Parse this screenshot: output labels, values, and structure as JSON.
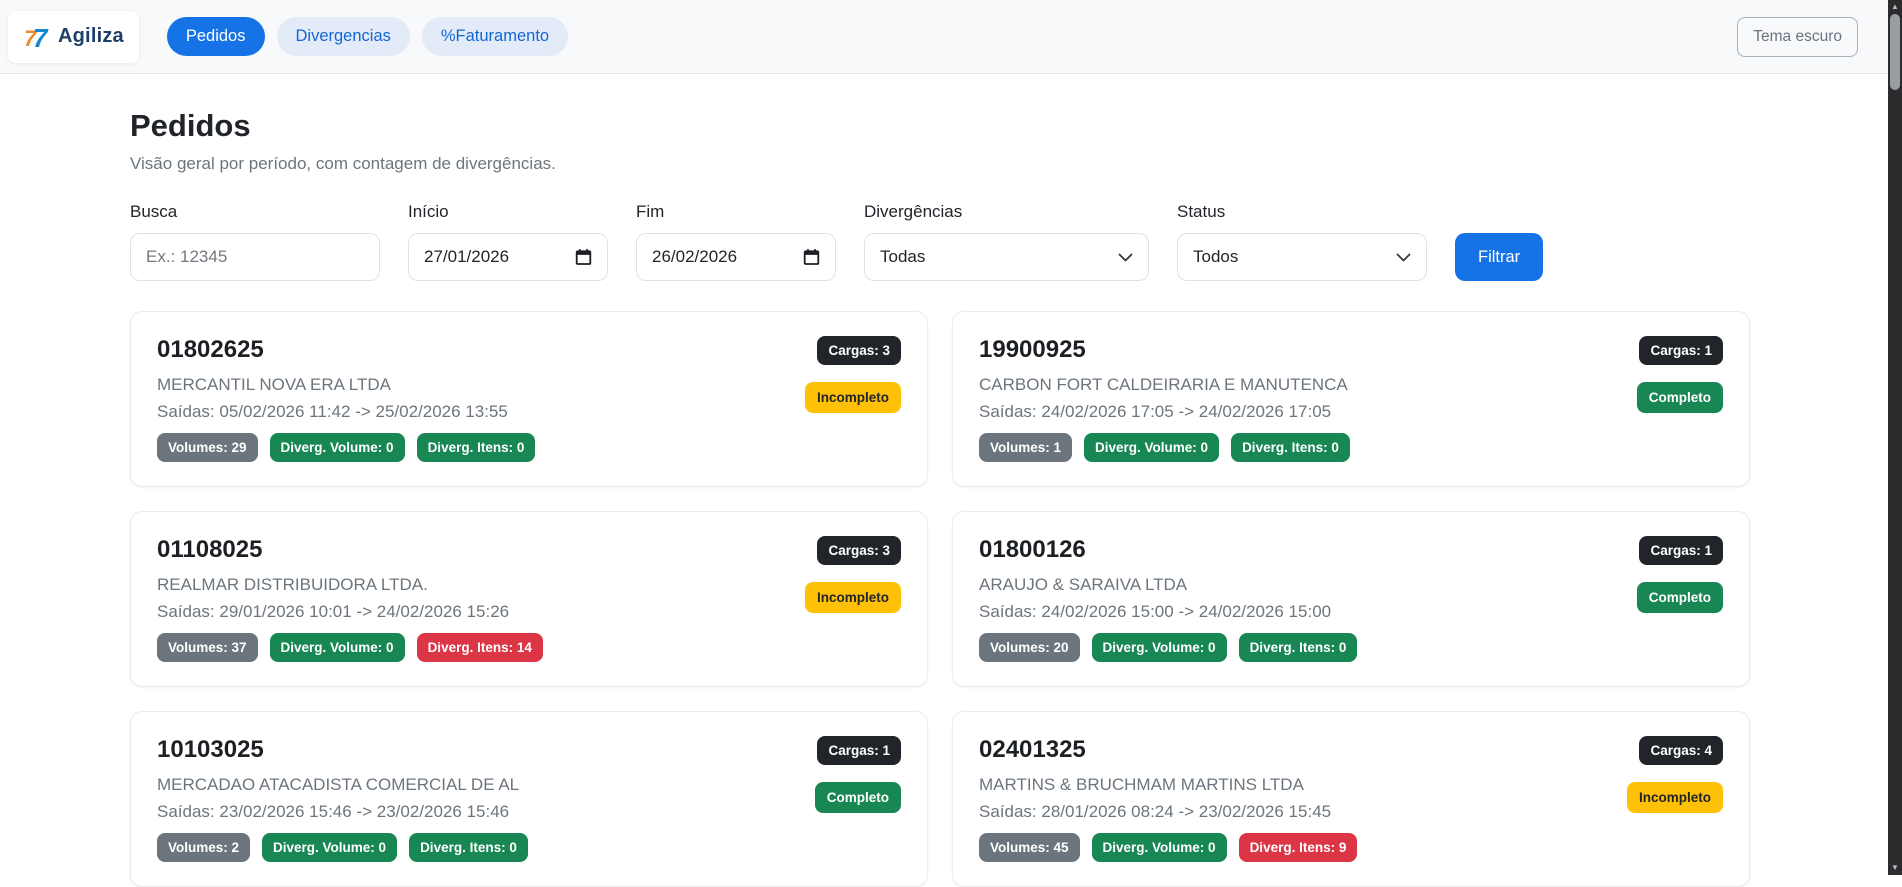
{
  "navbar": {
    "brand": "Agiliza",
    "tabs": [
      {
        "label": "Pedidos",
        "active": true
      },
      {
        "label": "Divergencias",
        "active": false
      },
      {
        "label": "%Faturamento",
        "active": false
      }
    ],
    "theme_button": "Tema escuro"
  },
  "page": {
    "title": "Pedidos",
    "subtitle": "Visão geral por período, com contagem de divergências."
  },
  "filters": {
    "busca": {
      "label": "Busca",
      "placeholder": "Ex.: 12345",
      "value": ""
    },
    "inicio": {
      "label": "Início",
      "value": "27/01/2026"
    },
    "fim": {
      "label": "Fim",
      "value": "26/02/2026"
    },
    "divergencias": {
      "label": "Divergências",
      "selected": "Todas"
    },
    "status": {
      "label": "Status",
      "selected": "Todos"
    },
    "submit_label": "Filtrar"
  },
  "orders": [
    {
      "number": "01802625",
      "cargas_label": "Cargas: 3",
      "company": "MERCANTIL NOVA ERA LTDA",
      "saidas": "Saídas: 05/02/2026 11:42 -> 25/02/2026 13:55",
      "status": "Incompleto",
      "status_type": "warning",
      "badges": [
        {
          "label": "Volumes: 29",
          "type": "gray"
        },
        {
          "label": "Diverg. Volume: 0",
          "type": "green"
        },
        {
          "label": "Diverg. Itens: 0",
          "type": "green"
        }
      ]
    },
    {
      "number": "19900925",
      "cargas_label": "Cargas: 1",
      "company": "CARBON FORT CALDEIRARIA E MANUTENCA",
      "saidas": "Saídas: 24/02/2026 17:05 -> 24/02/2026 17:05",
      "status": "Completo",
      "status_type": "success",
      "badges": [
        {
          "label": "Volumes: 1",
          "type": "gray"
        },
        {
          "label": "Diverg. Volume: 0",
          "type": "green"
        },
        {
          "label": "Diverg. Itens: 0",
          "type": "green"
        }
      ]
    },
    {
      "number": "01108025",
      "cargas_label": "Cargas: 3",
      "company": "REALMAR DISTRIBUIDORA LTDA.",
      "saidas": "Saídas: 29/01/2026 10:01 -> 24/02/2026 15:26",
      "status": "Incompleto",
      "status_type": "warning",
      "badges": [
        {
          "label": "Volumes: 37",
          "type": "gray"
        },
        {
          "label": "Diverg. Volume: 0",
          "type": "green"
        },
        {
          "label": "Diverg. Itens: 14",
          "type": "red"
        }
      ]
    },
    {
      "number": "01800126",
      "cargas_label": "Cargas: 1",
      "company": "ARAUJO & SARAIVA LTDA",
      "saidas": "Saídas: 24/02/2026 15:00 -> 24/02/2026 15:00",
      "status": "Completo",
      "status_type": "success",
      "badges": [
        {
          "label": "Volumes: 20",
          "type": "gray"
        },
        {
          "label": "Diverg. Volume: 0",
          "type": "green"
        },
        {
          "label": "Diverg. Itens: 0",
          "type": "green"
        }
      ]
    },
    {
      "number": "10103025",
      "cargas_label": "Cargas: 1",
      "company": "MERCADAO ATACADISTA COMERCIAL DE AL",
      "saidas": "Saídas: 23/02/2026 15:46 -> 23/02/2026 15:46",
      "status": "Completo",
      "status_type": "success",
      "badges": [
        {
          "label": "Volumes: 2",
          "type": "gray"
        },
        {
          "label": "Diverg. Volume: 0",
          "type": "green"
        },
        {
          "label": "Diverg. Itens: 0",
          "type": "green"
        }
      ]
    },
    {
      "number": "02401325",
      "cargas_label": "Cargas: 4",
      "company": "MARTINS & BRUCHMAM MARTINS LTDA",
      "saidas": "Saídas: 28/01/2026 08:24 -> 23/02/2026 15:45",
      "status": "Incompleto",
      "status_type": "warning",
      "badges": [
        {
          "label": "Volumes: 45",
          "type": "gray"
        },
        {
          "label": "Diverg. Volume: 0",
          "type": "green"
        },
        {
          "label": "Diverg. Itens: 9",
          "type": "red"
        }
      ]
    }
  ],
  "colors": {
    "accent_blue": "#1673e6",
    "tab_inactive_bg": "#e4ebf8",
    "tab_inactive_text": "#1366d6",
    "badge_dark": "#212529",
    "badge_gray": "#6c757d",
    "badge_green": "#198754",
    "badge_red": "#dc3545",
    "badge_warning": "#ffc107",
    "muted_text": "#6c757d",
    "navbar_bg": "#f8f9fb"
  }
}
